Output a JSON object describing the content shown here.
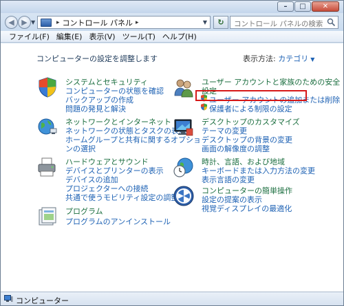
{
  "address_bar": {
    "path": [
      "コントロール パネル"
    ],
    "search_placeholder": "コントロール パネルの検索"
  },
  "menu": [
    "ファイル(F)",
    "編集(E)",
    "表示(V)",
    "ツール(T)",
    "ヘルプ(H)"
  ],
  "content": {
    "heading": "コンピューターの設定を調整します",
    "view_by_label": "表示方法:",
    "view_by_value": "カテゴリ"
  },
  "categories": {
    "system": {
      "icon": "system-security-shield-icon",
      "title": "システムとセキュリティ",
      "links": [
        "コンピューターの状態を確認",
        "バックアップの作成",
        "問題の発見と解決"
      ]
    },
    "network": {
      "icon": "network-globe-icon",
      "title": "ネットワークとインターネット",
      "links": [
        "ネットワークの状態とタスクの表示",
        "ホームグループと共有に関するオプショ",
        "ンの選択"
      ]
    },
    "hardware": {
      "icon": "printer-icon",
      "title": "ハードウェアとサウンド",
      "links": [
        "デバイスとプリンターの表示",
        "デバイスの追加",
        "プロジェクターへの接続",
        "共通で使うモビリティ設定の調整"
      ]
    },
    "programs": {
      "icon": "programs-icon",
      "title": "プログラム",
      "links": [
        "プログラムのアンインストール"
      ]
    },
    "users": {
      "icon": "users-icon",
      "title": "ユーザー アカウントと家族のための安全",
      "title2": "設定",
      "links": [
        "ユーザー アカウントの追加または削除",
        "保護者による制限の設定"
      ]
    },
    "appearance": {
      "icon": "display-icon",
      "title": "デスクトップのカスタマイズ",
      "links": [
        "テーマの変更",
        "デスクトップの背景の変更",
        "画面の解像度の調整"
      ]
    },
    "clock": {
      "icon": "clock-globe-icon",
      "title": "時計、言語、および地域",
      "links": [
        "キーボードまたは入力方法の変更",
        "表示言語の変更"
      ]
    },
    "ease": {
      "icon": "ease-of-access-icon",
      "title": "コンピューターの簡単操作",
      "links": [
        "設定の提案の表示",
        "視覚ディスプレイの最適化"
      ]
    }
  },
  "status_bar": {
    "text": "コンピューター"
  },
  "colors": {
    "link": "#1e62b4",
    "category_title": "#1b6e3f",
    "highlight": "#d61818"
  }
}
